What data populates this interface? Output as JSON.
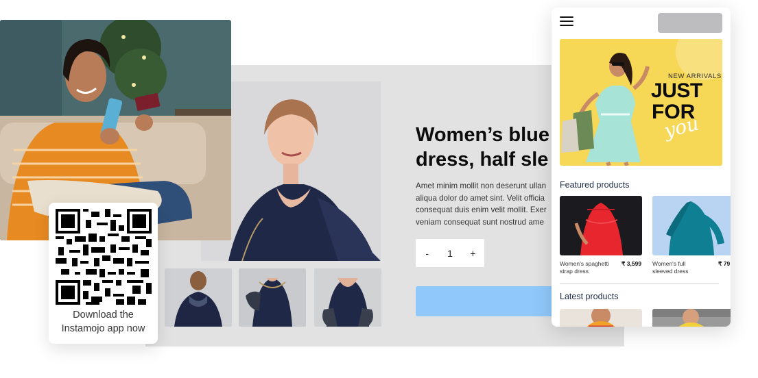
{
  "product": {
    "title_line1": "Women’s blue",
    "title_line2": "dress, half sle",
    "desc_lines": [
      "Amet minim mollit non deserunt ullan",
      "aliqua dolor do amet sint. Velit officia",
      "consequat duis enim velit mollit. Exer",
      "veniam consequat sunt nostrud ame"
    ],
    "qty_minus": "-",
    "qty_value": "1",
    "qty_plus": "+"
  },
  "qr_card": {
    "line1": "Download the",
    "line2": "Instamojo app now"
  },
  "mobile": {
    "banner": {
      "kicker": "NEW ARRIVALS",
      "line1": "JUST",
      "line2": "FOR",
      "script": "you"
    },
    "featured_title": "Featured products",
    "featured": [
      {
        "name_line1": "Women's spaghetti",
        "name_line2": "strap dress",
        "price": "₹ 3,599"
      },
      {
        "name_line1": "Women's full",
        "name_line2": "sleeved dress",
        "price": "₹ 79"
      }
    ],
    "latest_title": "Latest products"
  },
  "colors": {
    "panel_bg": "#e2e2e2",
    "buy_button": "#90c8fb",
    "banner_yellow": "#f6d756",
    "pill_gray": "#bdbdbf"
  },
  "icons": {
    "menu": "hamburger-menu-icon",
    "qr": "qr-code"
  }
}
